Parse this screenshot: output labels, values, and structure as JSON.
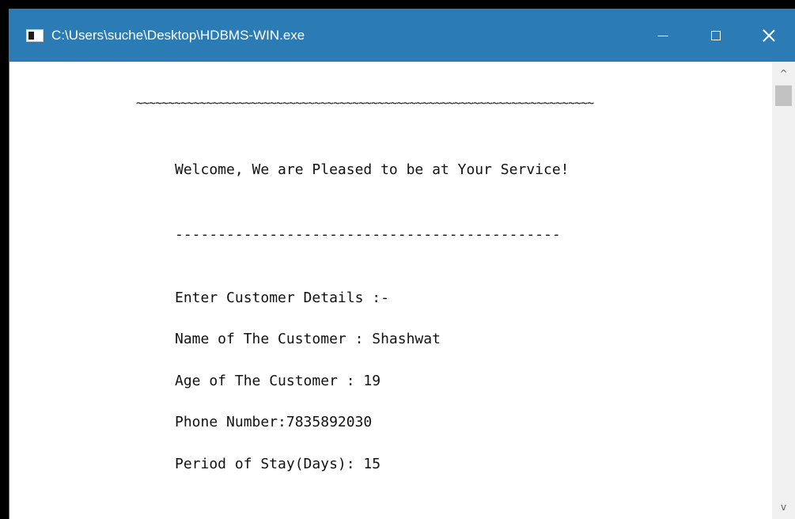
{
  "window": {
    "title": "C:\\Users\\suche\\Desktop\\HDBMS-WIN.exe",
    "icon": "console-app-icon",
    "controls": {
      "minimize": "minimize-icon",
      "maximize": "maximize-icon",
      "close": "close-icon"
    },
    "accent_color": "#2b7cb5"
  },
  "console": {
    "lines": {
      "tilde_rule": "~~~~~~~~~~~~~~~~~~~~~~~~~~~~~~~~~~~~~~~~~~~~~~~~~~~~~~~~~~~~~~~~~~~~~~~~",
      "welcome": "Welcome, We are Pleased to be at Your Service!",
      "dash_rule": "---------------------------------------------",
      "enter_details": "Enter Customer Details :-",
      "name": "Name of The Customer : Shashwat",
      "age": "Age of The Customer : 19",
      "phone": "Phone Number:7835892030",
      "period": "Period of Stay(Days): 15"
    }
  },
  "scrollbar": {
    "up_arrow": "^",
    "down_arrow": "v"
  }
}
